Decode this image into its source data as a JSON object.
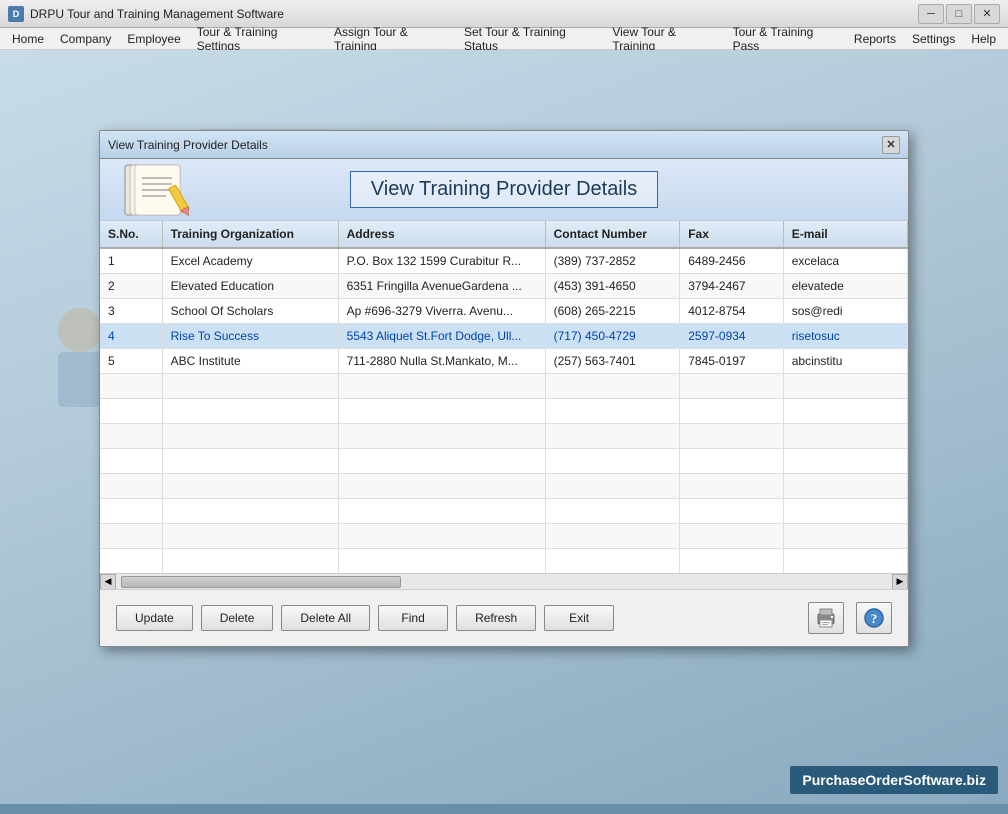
{
  "app": {
    "title": "DRPU Tour and Training Management Software",
    "icon_label": "D"
  },
  "title_bar": {
    "minimize": "─",
    "maximize": "□",
    "close": "✕"
  },
  "menu": {
    "items": [
      "Home",
      "Company",
      "Employee",
      "Tour & Training Settings",
      "Assign Tour & Training",
      "Set Tour & Training Status",
      "View Tour & Training",
      "Tour & Training Pass",
      "Reports",
      "Settings",
      "Help"
    ]
  },
  "modal": {
    "title": "View Training Provider Details",
    "header_title": "View Training Provider Details",
    "close_btn": "✕",
    "table": {
      "columns": [
        "S.No.",
        "Training Organization",
        "Address",
        "Contact Number",
        "Fax",
        "E-mail"
      ],
      "rows": [
        {
          "sno": "1",
          "org": "Excel Academy",
          "address": "P.O. Box 132 1599 Curabitur R...",
          "contact": "(389) 737-2852",
          "fax": "6489-2456",
          "email": "excelaca"
        },
        {
          "sno": "2",
          "org": "Elevated Education",
          "address": "6351 Fringilla AvenueGardena ...",
          "contact": "(453) 391-4650",
          "fax": "3794-2467",
          "email": "elevatede"
        },
        {
          "sno": "3",
          "org": "School Of Scholars",
          "address": "Ap #696-3279 Viverra. Avenu...",
          "contact": "(608) 265-2215",
          "fax": "4012-8754",
          "email": "sos@redi"
        },
        {
          "sno": "4",
          "org": "Rise To Success",
          "address": "5543 Aliquet St.Fort Dodge, Ull...",
          "contact": "(717) 450-4729",
          "fax": "2597-0934",
          "email": "risetosuc"
        },
        {
          "sno": "5",
          "org": "ABC Institute",
          "address": "711-2880 Nulla St.Mankato, M...",
          "contact": "(257) 563-7401",
          "fax": "7845-0197",
          "email": "abcinstitu"
        }
      ],
      "empty_rows": 8
    },
    "buttons": {
      "update": "Update",
      "delete": "Delete",
      "delete_all": "Delete All",
      "find": "Find",
      "refresh": "Refresh",
      "exit": "Exit"
    }
  },
  "watermark": "PurchaseOrderSoftware.biz",
  "colors": {
    "selected_row_color": "#0044aa",
    "selected_row_bg": "#cce0f4"
  }
}
